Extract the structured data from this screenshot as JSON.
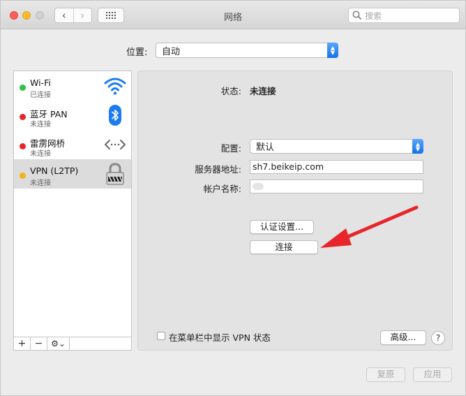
{
  "window": {
    "title": "网络"
  },
  "toolbar": {
    "back": "‹",
    "forward": "›",
    "search_placeholder": "搜索"
  },
  "location": {
    "label": "位置:",
    "value": "自动"
  },
  "services": [
    {
      "name": "Wi-Fi",
      "status": "已连接",
      "dot_color": "#2fc24a",
      "icon": "wifi-icon"
    },
    {
      "name": "蓝牙 PAN",
      "status": "未连接",
      "dot_color": "#e8242b",
      "icon": "bluetooth-icon"
    },
    {
      "name": "雷雳网桥",
      "status": "未连接",
      "dot_color": "#e8242b",
      "icon": "thunderbolt-bridge-icon"
    },
    {
      "name": "VPN (L2TP)",
      "status": "未连接",
      "dot_color": "#f3b21b",
      "icon": "vpn-lock-icon"
    }
  ],
  "sidebar_footer": {
    "add": "+",
    "remove": "−",
    "gear": "⚙︎⌄"
  },
  "detail": {
    "status_label": "状态:",
    "status_value": "未连接",
    "config_label": "配置:",
    "config_value": "默认",
    "server_label": "服务器地址:",
    "server_value": "sh7.beikeip.com",
    "account_label": "帐户名称:",
    "account_value": "",
    "auth_button": "认证设置...",
    "connect_button": "连接",
    "show_vpn_checkbox": "在菜单栏中显示 VPN 状态",
    "advanced_button": "高级...",
    "help_button": "?"
  },
  "bottom": {
    "revert": "复原",
    "apply": "应用"
  },
  "colors": {
    "accent": "#1a7cf0",
    "annotation_arrow": "#e8252b"
  }
}
